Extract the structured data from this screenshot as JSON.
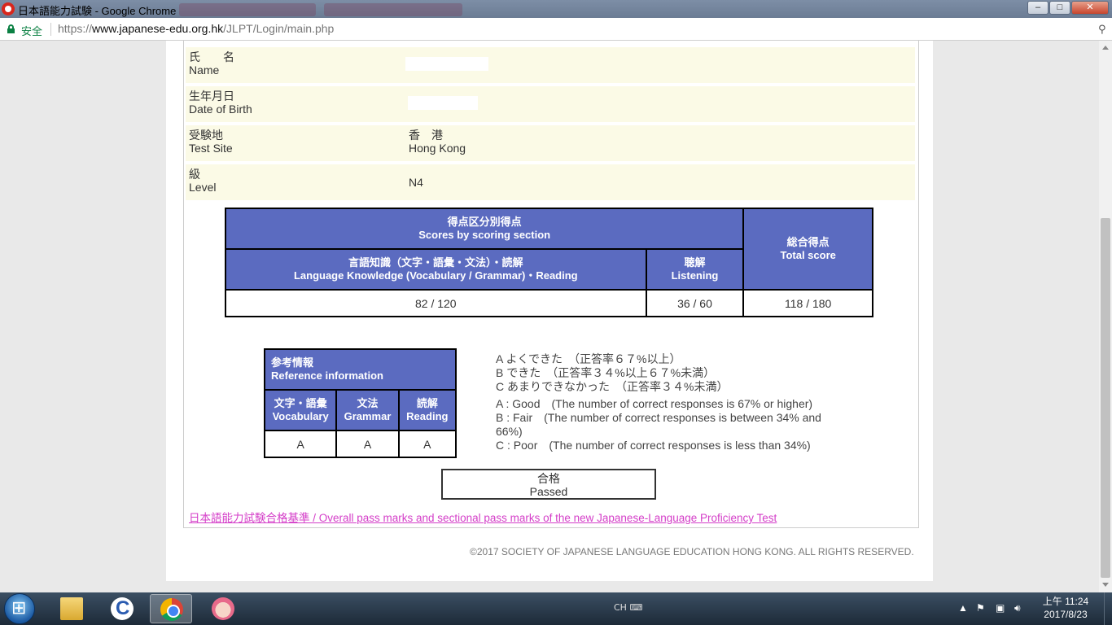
{
  "window": {
    "title": "日本語能力試験 - Google Chrome",
    "minimize": "–",
    "maximize": "□",
    "close": "✕"
  },
  "address": {
    "secure_label": "安全",
    "url_scheme": "https://",
    "url_domain": "www.japanese-edu.org.hk",
    "url_path": "/JLPT/Login/main.php"
  },
  "candidate": {
    "name_label_jp": "氏　　名",
    "name_label_en": "Name",
    "dob_label_jp": "生年月日",
    "dob_label_en": "Date of Birth",
    "site_label_jp": "受験地",
    "site_label_en": "Test Site",
    "site_value_jp": "香　港",
    "site_value_en": "Hong Kong",
    "level_label_jp": "級",
    "level_label_en": "Level",
    "level_value": "N4"
  },
  "scores": {
    "section_header_jp": "得点区分別得点",
    "section_header_en": "Scores by scoring section",
    "total_header_jp": "総合得点",
    "total_header_en": "Total score",
    "lk_header_jp": "言語知識（文字・語彙・文法）・読解",
    "lk_header_en": "Language Knowledge (Vocabulary / Grammar)・Reading",
    "listening_header_jp": "聴解",
    "listening_header_en": "Listening",
    "lk_score": "82 / 120",
    "listening_score": "36 / 60",
    "total_score": "118 / 180"
  },
  "reference": {
    "header_jp": "参考情報",
    "header_en": "Reference information",
    "vocab_jp": "文字・語彙",
    "vocab_en": "Vocabulary",
    "grammar_jp": "文法",
    "grammar_en": "Grammar",
    "reading_jp": "読解",
    "reading_en": "Reading",
    "vocab_grade": "A",
    "grammar_grade": "A",
    "reading_grade": "A"
  },
  "legend": {
    "a_jp": "A よくできた　（正答率６７%以上）",
    "b_jp": "B できた　（正答率３４%以上６７%未満）",
    "c_jp": "C あまりできなかった　（正答率３４%未満）",
    "a_en": "A : Good　(The number of correct responses is 67% or higher)",
    "b_en_1": "B : Fair　(The number of correct responses is between 34% and",
    "b_en_2": "66%)",
    "c_en": "C : Poor　(The number of correct responses is less than 34%)"
  },
  "result": {
    "jp": "合格",
    "en": "Passed"
  },
  "pass_marks_link": "日本語能力試験合格基準 / Overall pass marks and sectional pass marks of the new Japanese-Language Proficiency Test",
  "copyright": "©2017 SOCIETY OF JAPANESE LANGUAGE EDUCATION HONG KONG. ALL RIGHTS RESERVED.",
  "taskbar": {
    "ime": "CH",
    "time": "上午 11:24",
    "date": "2017/8/23"
  },
  "colors": {
    "table_header": "#5b6bc0",
    "info_row_bg": "#fbfae6",
    "link": "#d43ec8"
  }
}
